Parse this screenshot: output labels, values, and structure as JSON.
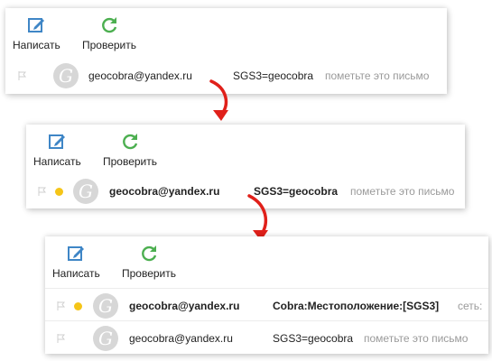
{
  "toolbar": {
    "compose_label": "Написать",
    "check_label": "Проверить",
    "compose_icon": "compose-icon",
    "check_icon": "refresh-icon"
  },
  "panel1": {
    "rows": [
      {
        "sender": "geocobra@yandex.ru",
        "subject": "SGS3=geocobra",
        "snippet": "пометьте это письмо",
        "unread": false
      }
    ]
  },
  "panel2": {
    "rows": [
      {
        "sender": "geocobra@yandex.ru",
        "subject": "SGS3=geocobra",
        "snippet": "пометьте это письмо",
        "unread": true
      }
    ]
  },
  "panel3": {
    "rows": [
      {
        "sender": "geocobra@yandex.ru",
        "subject": "Cobra:Местоположение:[SGS3]",
        "snippet": "сеть:",
        "unread": true
      },
      {
        "sender": "geocobra@yandex.ru",
        "subject": "SGS3=geocobra",
        "snippet": "пометьте это письмо",
        "unread": false
      }
    ]
  },
  "avatar_letter": "G",
  "colors": {
    "unread_dot": "#f5c518",
    "arrow": "#e0201a",
    "compose_icon": "#3f86c6",
    "check_icon": "#4caf50"
  }
}
